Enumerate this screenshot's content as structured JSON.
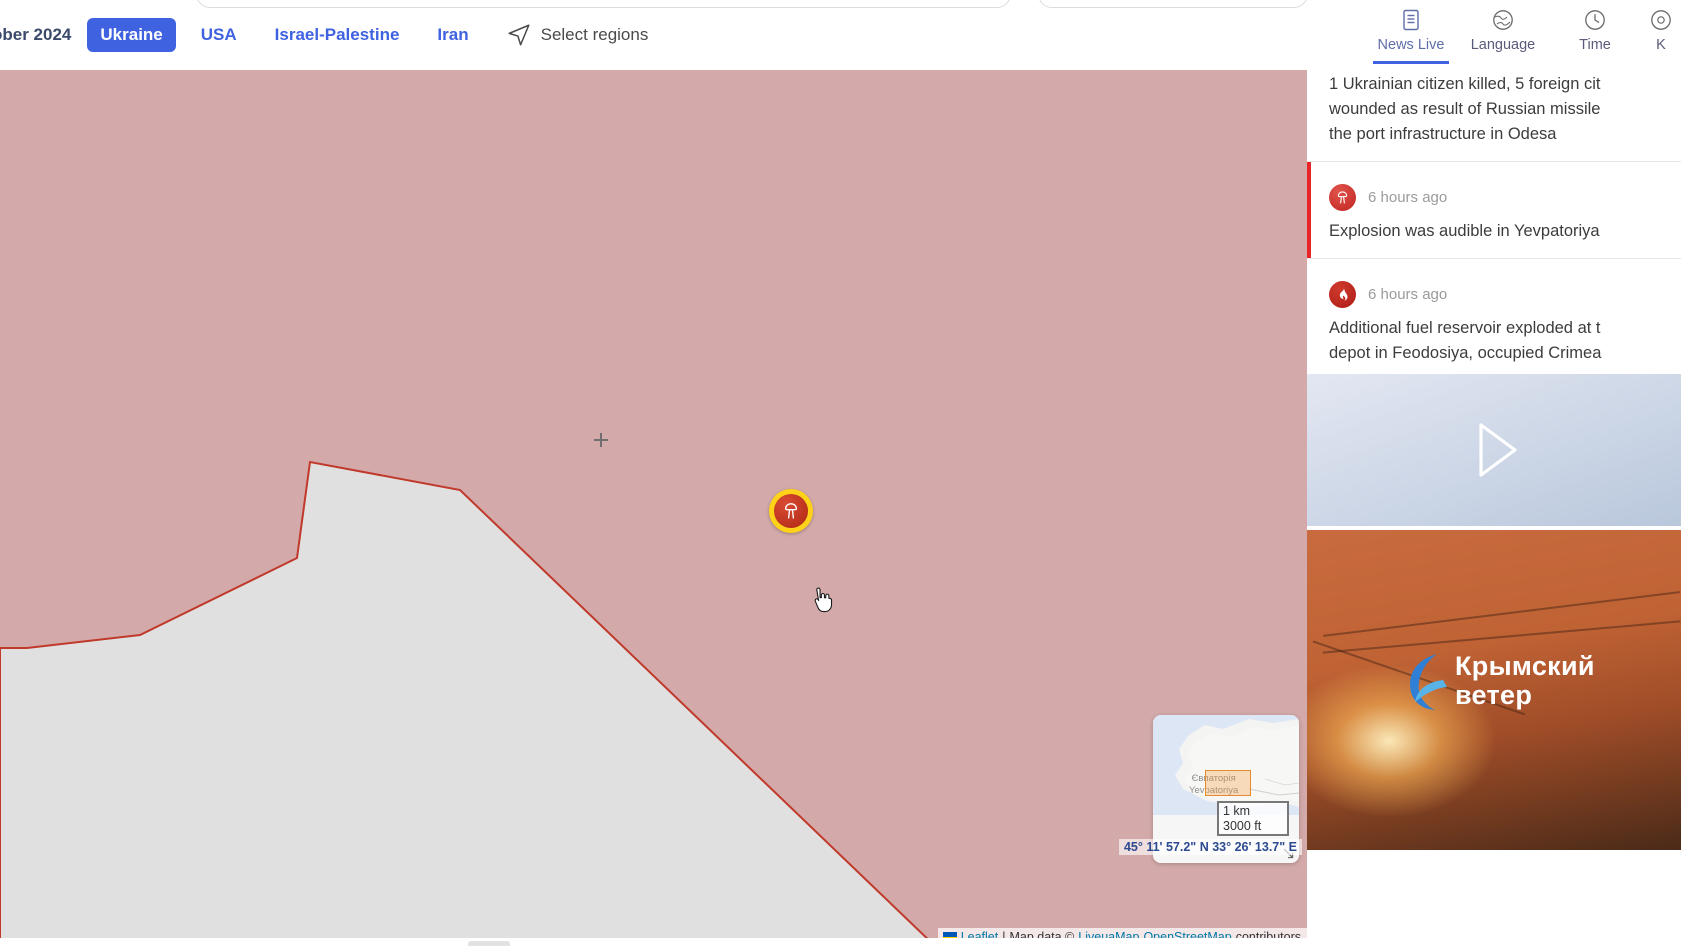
{
  "topbar": {
    "date_label": "ober 2024",
    "regions": [
      {
        "label": "Ukraine",
        "active": true
      },
      {
        "label": "USA",
        "active": false
      },
      {
        "label": "Israel-Palestine",
        "active": false
      },
      {
        "label": "Iran",
        "active": false
      }
    ],
    "select_regions_label": "Select regions",
    "select_regions_icon": "navigation-arrow-icon",
    "tools": [
      {
        "label": "News Live",
        "icon": "list-document-icon",
        "active": true
      },
      {
        "label": "Language",
        "icon": "globe-icon",
        "active": false
      },
      {
        "label": "Time",
        "icon": "clock-icon",
        "active": false
      },
      {
        "label": "K",
        "icon": "gear-icon",
        "active": false
      }
    ]
  },
  "map": {
    "background_color": "#d3a9a9",
    "land_color": "#e0e0e0",
    "border_color": "#c0392b",
    "marker": {
      "icon": "nuclear-explosion-icon",
      "ring_color": "#ffd21a",
      "fill_color": "#c9302c"
    },
    "crosshair_icon": "crosshair-icon",
    "cursor_icon": "pointer-hand-cursor-icon",
    "minimap": {
      "label_cyrillic": "Євпаторія",
      "label_latin": "Yevpatoriya",
      "toggle_icon": "collapse-minimap-icon"
    },
    "scale_metric": "1 km",
    "scale_imperial": "3000 ft",
    "coordinates": "45° 11' 57.2\" N 33° 26' 13.7\" E",
    "attribution": {
      "flag_icon": "ukraine-flag-icon",
      "leaflet": "Leaflet",
      "separator": "|",
      "map_data": "Map data ©",
      "source_a": "LiveuaMap",
      "source_b": "OpenStreetMap",
      "contributors": "contributors"
    }
  },
  "news": {
    "items": [
      {
        "text": "1 Ukrainian citizen killed, 5 foreign cit\nwounded as result of Russian missile\nthe port infrastructure in Odesa",
        "time": "",
        "icon": "",
        "highlighted": false,
        "clipped_top": true
      },
      {
        "text": "Explosion was audible in Yevpatoriya",
        "time": "6 hours ago",
        "icon": "nuclear-explosion-icon",
        "highlighted": true
      },
      {
        "text": "Additional fuel reservoir exploded at t\ndepot in Feodosiya, occupied Crimea",
        "time": "6 hours ago",
        "icon": "fire-icon",
        "highlighted": false,
        "media": {
          "video_icon": "play-triangle-icon",
          "photo_watermark_line1": "Крымский",
          "photo_watermark_line2": "ветер"
        }
      }
    ]
  }
}
